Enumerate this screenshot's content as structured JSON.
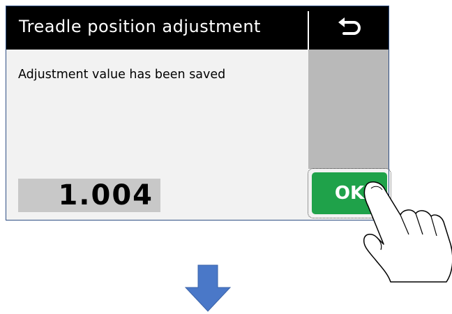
{
  "header": {
    "title": "Treadle position adjustment",
    "back_icon": "return-arrow-icon"
  },
  "main": {
    "message": "Adjustment value has been saved",
    "value": "1.004"
  },
  "ok_button": {
    "label": "OK"
  },
  "illustration": {
    "hand": "pointing-hand-icon",
    "arrow": "down-arrow-icon"
  },
  "colors": {
    "header_bg": "#000000",
    "ok_green": "#1fa24a",
    "panel_gray": "#b9b9b9",
    "value_bg": "#c8c8c8",
    "arrow_blue": "#4a78c8"
  }
}
